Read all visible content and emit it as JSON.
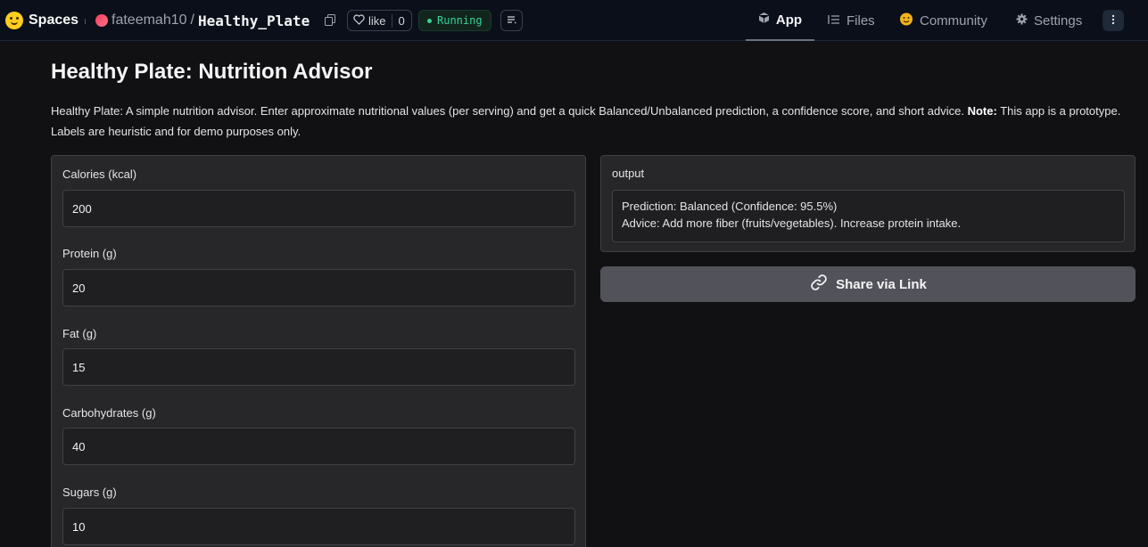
{
  "header": {
    "brand": "Spaces",
    "owner": "fateemah10",
    "separator": "/",
    "repo": "Healthy_Plate",
    "like_label": "like",
    "like_count": "0",
    "status": "Running",
    "status_color": "#34d399",
    "nav": {
      "app": "App",
      "files": "Files",
      "community": "Community",
      "settings": "Settings"
    },
    "icons": {
      "brand": "hugging-face-icon",
      "copy": "copy-icon",
      "like": "heart-icon",
      "lines": "list-icon",
      "app": "cube-icon",
      "files": "files-icon",
      "community": "community-icon",
      "settings": "gear-icon",
      "more": "more-vertical-icon"
    }
  },
  "app": {
    "title": "Healthy Plate: Nutrition Advisor",
    "description_main": "Healthy Plate: A simple nutrition advisor. Enter approximate nutritional values (per serving) and get a quick Balanced/Unbalanced prediction, a confidence score, and short advice. ",
    "description_note_label": "Note:",
    "description_note": " This app is a prototype. Labels are heuristic and for demo purposes only.",
    "inputs": [
      {
        "label": "Calories (kcal)",
        "value": "200"
      },
      {
        "label": "Protein (g)",
        "value": "20"
      },
      {
        "label": "Fat (g)",
        "value": "15"
      },
      {
        "label": "Carbohydrates (g)",
        "value": "40"
      },
      {
        "label": "Sugars (g)",
        "value": "10"
      }
    ],
    "output": {
      "label": "output",
      "line1": "Prediction: Balanced (Confidence: 95.5%)",
      "line2": "Advice: Add more fiber (fruits/vegetables). Increase protein intake."
    },
    "share_label": "Share via Link"
  }
}
